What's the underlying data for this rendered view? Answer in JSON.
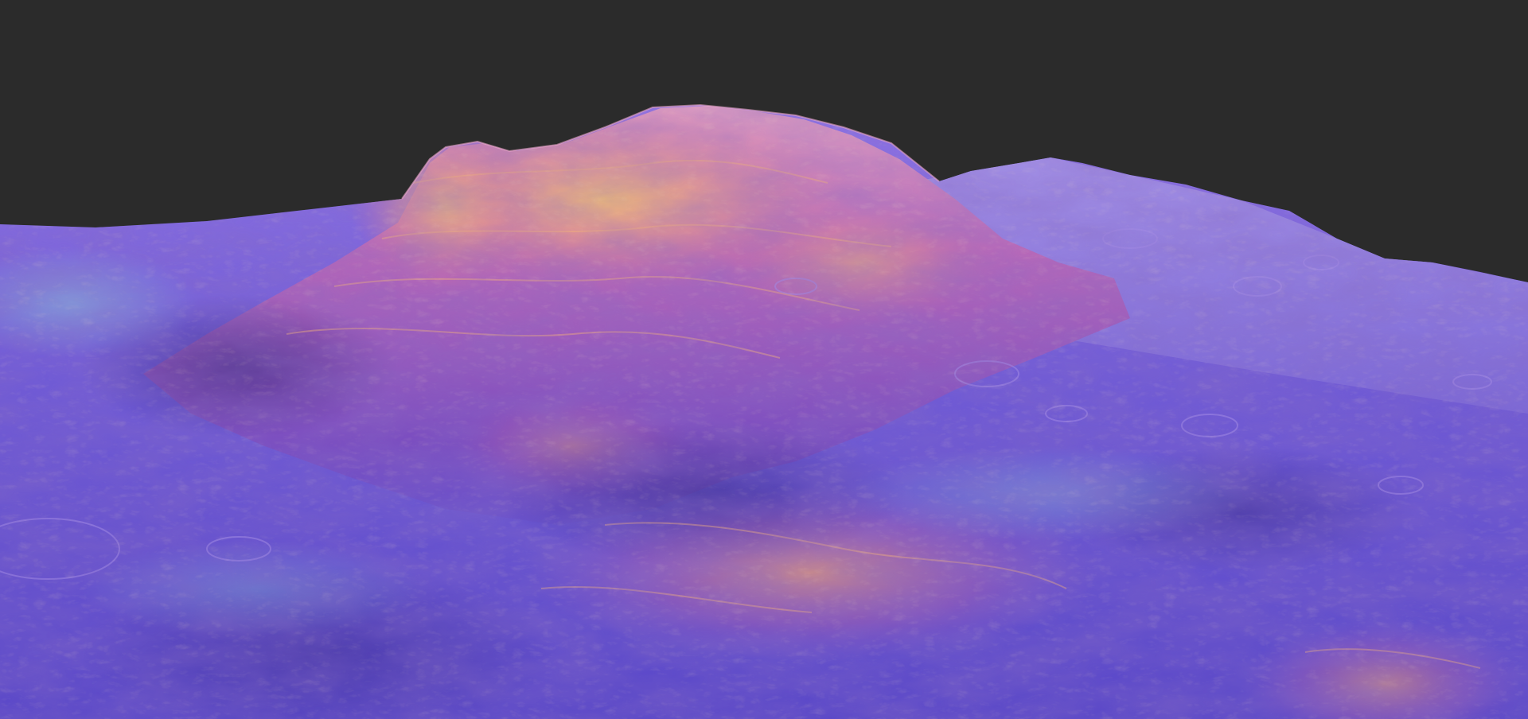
{
  "scene": {
    "subject": "3d-terrain-render",
    "background_color": "#2b2b2b",
    "palette": {
      "shadow": "#3a2a8a",
      "base": "#6a58d8",
      "midtone": "#9a4fc8",
      "highlight": "#e08a9a",
      "peak_glow": "#f2b36a",
      "rim": "#d8e0a0",
      "cool_lowland": "#7fa8e0"
    }
  }
}
